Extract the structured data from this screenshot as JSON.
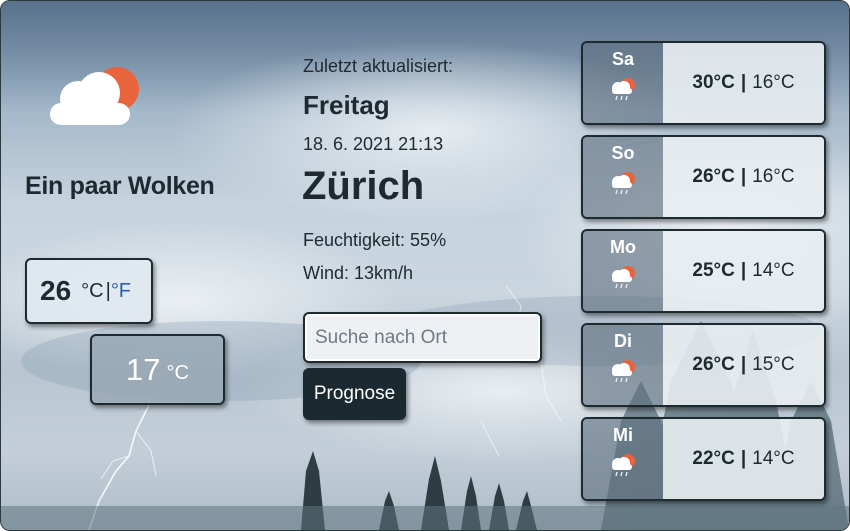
{
  "current": {
    "condition": "Ein paar Wolken",
    "temp": "26",
    "unit_c": "°C",
    "unit_sep": "|",
    "unit_f": "°F",
    "low_temp": "17",
    "low_unit": "°C"
  },
  "info": {
    "updated_label": "Zuletzt aktualisiert:",
    "day": "Freitag",
    "datetime": "18. 6. 2021 21:13",
    "city": "Zürich",
    "humidity": "Feuchtigkeit: 55%",
    "wind": "Wind: 13km/h"
  },
  "search": {
    "placeholder": "Suche nach Ort"
  },
  "forecast_button": {
    "label": "Prognose"
  },
  "forecast": [
    {
      "day": "Sa",
      "high": "30°C",
      "low": "16°C",
      "icon": "cloud-rain-sun-icon"
    },
    {
      "day": "So",
      "high": "26°C",
      "low": "16°C",
      "icon": "cloud-rain-sun-icon"
    },
    {
      "day": "Mo",
      "high": "25°C",
      "low": "14°C",
      "icon": "cloud-rain-sun-icon"
    },
    {
      "day": "Di",
      "high": "26°C",
      "low": "15°C",
      "icon": "cloud-rain-sun-icon"
    },
    {
      "day": "Mi",
      "high": "22°C",
      "low": "14°C",
      "icon": "cloud-rain-sun-icon"
    }
  ],
  "forecast_separator": "|",
  "colors": {
    "accent_sun": "#e8643c",
    "dark": "#1a2a30",
    "fahrenheit_link": "#2d5fae"
  }
}
